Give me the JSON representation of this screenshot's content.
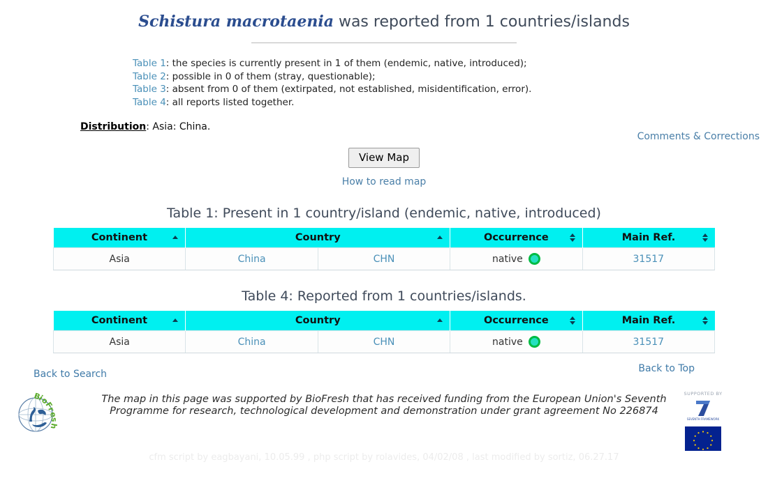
{
  "header": {
    "species_name": "Schistura macrotaenia",
    "title_suffix": " was reported from 1 countries/islands"
  },
  "summary": {
    "rows": [
      {
        "link": "Table 1",
        "text": ": the species is currently present in 1 of them (endemic, native, introduced);"
      },
      {
        "link": "Table 2",
        "text": ": possible in 0 of them (stray, questionable);"
      },
      {
        "link": "Table 3",
        "text": ": absent from 0 of them (extirpated, not established, misidentification, error)."
      },
      {
        "link": "Table 4",
        "text": ": all reports listed together."
      }
    ]
  },
  "distribution": {
    "label": "Distribution",
    "value": ": Asia: China."
  },
  "links": {
    "comments": "Comments & Corrections",
    "how_to_read_map": "How to read map",
    "back_to_search": "Back to Search",
    "back_to_top": "Back to Top"
  },
  "buttons": {
    "view_map": "View Map"
  },
  "tables": [
    {
      "caption": "Table 1: Present in 1 country/island (endemic, native, introduced)",
      "columns": [
        {
          "label": "Continent",
          "sort": "asc"
        },
        {
          "label": "Country",
          "sort": "asc"
        },
        {
          "label": "Occurrence",
          "sort": "both"
        },
        {
          "label": "Main Ref.",
          "sort": "both"
        }
      ],
      "rows": [
        {
          "continent": "Asia",
          "country": "China",
          "iso": "CHN",
          "occurrence": "native",
          "occurrence_color": "#00bb44",
          "main_ref": "31517"
        }
      ]
    },
    {
      "caption": "Table 4: Reported from 1 countries/islands.",
      "columns": [
        {
          "label": "Continent",
          "sort": "asc"
        },
        {
          "label": "Country",
          "sort": "asc"
        },
        {
          "label": "Occurrence",
          "sort": "both"
        },
        {
          "label": "Main Ref.",
          "sort": "both"
        }
      ],
      "rows": [
        {
          "continent": "Asia",
          "country": "China",
          "iso": "CHN",
          "occurrence": "native",
          "occurrence_color": "#00bb44",
          "main_ref": "31517"
        }
      ]
    }
  ],
  "footer": {
    "funding_text": "The map in this page was supported by BioFresh that has received funding from the European Union's Seventh Programme for research, technological development and demonstration under grant agreement No 226874",
    "biofresh_logo_label": "BioFresh",
    "supported_by": "SUPPORTED BY",
    "fp7_label": "7",
    "fp7_sub": "SEVENTH FRAMEWORK PROGRAMME",
    "credits": "cfm script by eagbayani, 10.05.99 ,  php script by rolavides, 04/02/08 ,  last modified by sortiz, 06.27.17"
  },
  "colors": {
    "header_cyan": "#00f0f0",
    "link_blue": "#4a90b8",
    "title_blue": "#2b4d8f",
    "occurrence_green": "#00bb44"
  }
}
